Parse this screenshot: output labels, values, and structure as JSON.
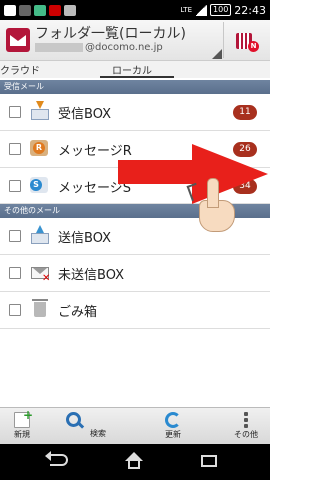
{
  "status_bar": {
    "battery": "100",
    "network": "LTE",
    "time": "22:43"
  },
  "header": {
    "title": "フォルダ一覧(ローカル)",
    "account": "@docomo.ne.jp"
  },
  "tabs": {
    "cloud": "クラウド",
    "local": "ローカル"
  },
  "sections": {
    "received": "受信メール",
    "other": "その他のメール"
  },
  "folders": [
    {
      "label": "受信BOX",
      "count": "11",
      "icon": "inbox-icon"
    },
    {
      "label": "メッセージR",
      "count": "26",
      "icon": "message-r-icon"
    },
    {
      "label": "メッセージS",
      "count": "34",
      "icon": "message-s-icon"
    }
  ],
  "other_folders": [
    {
      "label": "送信BOX",
      "icon": "outbox-icon"
    },
    {
      "label": "未送信BOX",
      "icon": "unsent-icon"
    },
    {
      "label": "ごみ箱",
      "icon": "trash-icon"
    }
  ],
  "toolbar": {
    "new": "新規",
    "search": "検索",
    "refresh": "更新",
    "other": "その他"
  },
  "colors": {
    "brand": "#b3163a",
    "count_badge": "#a8301e",
    "section_bg": "#5a6f8c",
    "arrow": "#e8201b"
  }
}
